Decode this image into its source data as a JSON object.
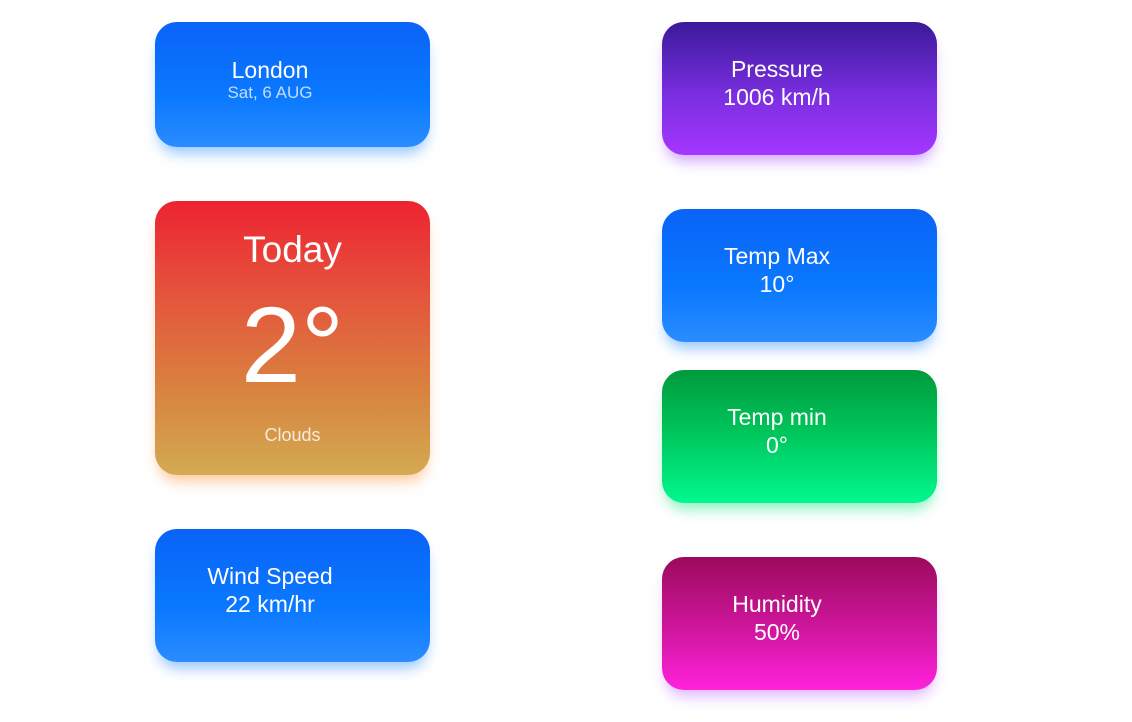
{
  "location": {
    "city": "London",
    "date": "Sat, 6 AUG"
  },
  "today": {
    "label": "Today",
    "temperature": "2°",
    "condition": "Clouds"
  },
  "wind": {
    "label": "Wind Speed",
    "value": "22 km/hr"
  },
  "pressure": {
    "label": "Pressure",
    "value": "1006 km/h"
  },
  "temp_max": {
    "label": "Temp Max",
    "value": "10°"
  },
  "temp_min": {
    "label": "Temp min",
    "value": "0°"
  },
  "humidity": {
    "label": "Humidity",
    "value": "50%"
  },
  "colors": {
    "blue": "#0a79ff",
    "purple": "#7a2ee0",
    "red": "#ec2331",
    "orange": "#d3aa52",
    "green": "#00c85d",
    "magenta": "#d0169f"
  }
}
